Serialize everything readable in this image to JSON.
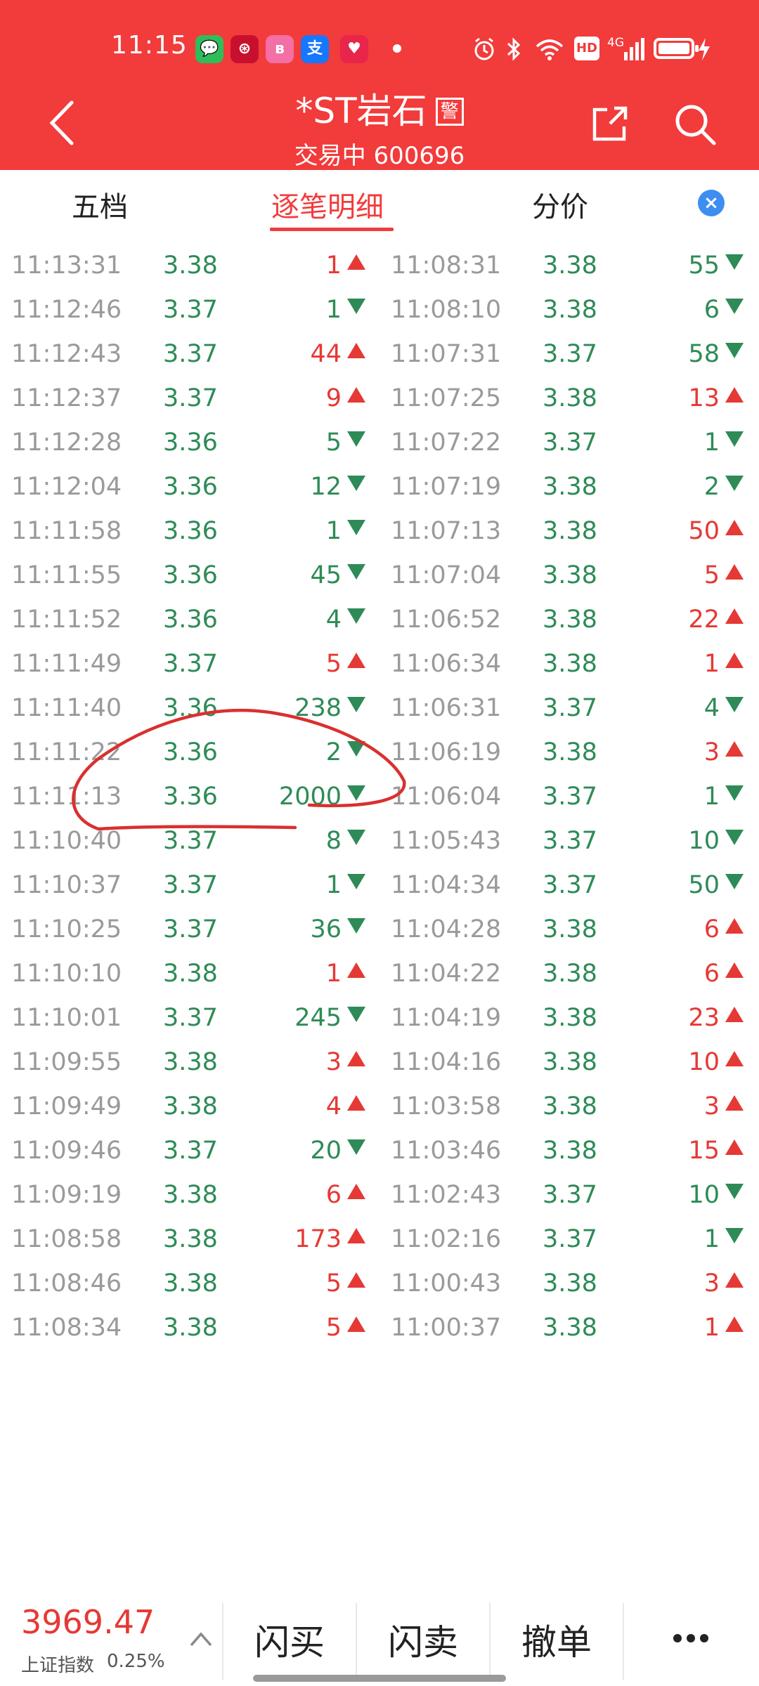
{
  "status": {
    "time": "11:15",
    "hd": "HD",
    "network": "4G",
    "notifications": [
      {
        "icon": "message-icon",
        "color": "#2fbd5a",
        "glyph": "💬"
      },
      {
        "icon": "bank-icon",
        "color": "#c8102e",
        "glyph": "⊛"
      },
      {
        "icon": "bilibili-icon",
        "color": "#f36fa5",
        "glyph": "ʙ"
      },
      {
        "icon": "alipay-icon",
        "color": "#1677ff",
        "glyph": "支"
      },
      {
        "icon": "heart-app-icon",
        "color": "#e8254a",
        "glyph": "♥"
      }
    ]
  },
  "header": {
    "stock_name": "*ST岩石",
    "warn_badge": "警",
    "status_text": "交易中",
    "stock_code": "600696"
  },
  "tabs": [
    {
      "label": "五档",
      "active": false
    },
    {
      "label": "逐笔明细",
      "active": true
    },
    {
      "label": "分价",
      "active": false
    }
  ],
  "ticks_left": [
    {
      "time": "11:13:31",
      "price": "3.38",
      "volume": "1",
      "dir": "up"
    },
    {
      "time": "11:12:46",
      "price": "3.37",
      "volume": "1",
      "dir": "down"
    },
    {
      "time": "11:12:43",
      "price": "3.37",
      "volume": "44",
      "dir": "up"
    },
    {
      "time": "11:12:37",
      "price": "3.37",
      "volume": "9",
      "dir": "up"
    },
    {
      "time": "11:12:28",
      "price": "3.36",
      "volume": "5",
      "dir": "down"
    },
    {
      "time": "11:12:04",
      "price": "3.36",
      "volume": "12",
      "dir": "down"
    },
    {
      "time": "11:11:58",
      "price": "3.36",
      "volume": "1",
      "dir": "down"
    },
    {
      "time": "11:11:55",
      "price": "3.36",
      "volume": "45",
      "dir": "down"
    },
    {
      "time": "11:11:52",
      "price": "3.36",
      "volume": "4",
      "dir": "down"
    },
    {
      "time": "11:11:49",
      "price": "3.37",
      "volume": "5",
      "dir": "up"
    },
    {
      "time": "11:11:40",
      "price": "3.36",
      "volume": "238",
      "dir": "down"
    },
    {
      "time": "11:11:22",
      "price": "3.36",
      "volume": "2",
      "dir": "down"
    },
    {
      "time": "11:11:13",
      "price": "3.36",
      "volume": "2000",
      "dir": "down"
    },
    {
      "time": "11:10:40",
      "price": "3.37",
      "volume": "8",
      "dir": "down"
    },
    {
      "time": "11:10:37",
      "price": "3.37",
      "volume": "1",
      "dir": "down"
    },
    {
      "time": "11:10:25",
      "price": "3.37",
      "volume": "36",
      "dir": "down"
    },
    {
      "time": "11:10:10",
      "price": "3.38",
      "volume": "1",
      "dir": "up"
    },
    {
      "time": "11:10:01",
      "price": "3.37",
      "volume": "245",
      "dir": "down"
    },
    {
      "time": "11:09:55",
      "price": "3.38",
      "volume": "3",
      "dir": "up"
    },
    {
      "time": "11:09:49",
      "price": "3.38",
      "volume": "4",
      "dir": "up"
    },
    {
      "time": "11:09:46",
      "price": "3.37",
      "volume": "20",
      "dir": "down"
    },
    {
      "time": "11:09:19",
      "price": "3.38",
      "volume": "6",
      "dir": "up"
    },
    {
      "time": "11:08:58",
      "price": "3.38",
      "volume": "173",
      "dir": "up"
    },
    {
      "time": "11:08:46",
      "price": "3.38",
      "volume": "5",
      "dir": "up"
    },
    {
      "time": "11:08:34",
      "price": "3.38",
      "volume": "5",
      "dir": "up"
    }
  ],
  "ticks_right": [
    {
      "time": "11:08:31",
      "price": "3.38",
      "volume": "55",
      "dir": "down"
    },
    {
      "time": "11:08:10",
      "price": "3.38",
      "volume": "6",
      "dir": "down"
    },
    {
      "time": "11:07:31",
      "price": "3.37",
      "volume": "58",
      "dir": "down"
    },
    {
      "time": "11:07:25",
      "price": "3.38",
      "volume": "13",
      "dir": "up"
    },
    {
      "time": "11:07:22",
      "price": "3.37",
      "volume": "1",
      "dir": "down"
    },
    {
      "time": "11:07:19",
      "price": "3.38",
      "volume": "2",
      "dir": "down"
    },
    {
      "time": "11:07:13",
      "price": "3.38",
      "volume": "50",
      "dir": "up"
    },
    {
      "time": "11:07:04",
      "price": "3.38",
      "volume": "5",
      "dir": "up"
    },
    {
      "time": "11:06:52",
      "price": "3.38",
      "volume": "22",
      "dir": "up"
    },
    {
      "time": "11:06:34",
      "price": "3.38",
      "volume": "1",
      "dir": "up"
    },
    {
      "time": "11:06:31",
      "price": "3.37",
      "volume": "4",
      "dir": "down"
    },
    {
      "time": "11:06:19",
      "price": "3.38",
      "volume": "3",
      "dir": "up"
    },
    {
      "time": "11:06:04",
      "price": "3.37",
      "volume": "1",
      "dir": "down"
    },
    {
      "time": "11:05:43",
      "price": "3.37",
      "volume": "10",
      "dir": "down"
    },
    {
      "time": "11:04:34",
      "price": "3.37",
      "volume": "50",
      "dir": "down"
    },
    {
      "time": "11:04:28",
      "price": "3.38",
      "volume": "6",
      "dir": "up"
    },
    {
      "time": "11:04:22",
      "price": "3.38",
      "volume": "6",
      "dir": "up"
    },
    {
      "time": "11:04:19",
      "price": "3.38",
      "volume": "23",
      "dir": "up"
    },
    {
      "time": "11:04:16",
      "price": "3.38",
      "volume": "10",
      "dir": "up"
    },
    {
      "time": "11:03:58",
      "price": "3.38",
      "volume": "3",
      "dir": "up"
    },
    {
      "time": "11:03:46",
      "price": "3.38",
      "volume": "15",
      "dir": "up"
    },
    {
      "time": "11:02:43",
      "price": "3.37",
      "volume": "10",
      "dir": "down"
    },
    {
      "time": "11:02:16",
      "price": "3.37",
      "volume": "1",
      "dir": "down"
    },
    {
      "time": "11:00:43",
      "price": "3.38",
      "volume": "3",
      "dir": "up"
    },
    {
      "time": "11:00:37",
      "price": "3.38",
      "volume": "1",
      "dir": "up"
    }
  ],
  "bottom": {
    "index_value": "3969.47",
    "index_name": "上证指数",
    "index_change": "0.25%",
    "actions": [
      "闪买",
      "闪卖",
      "撤单"
    ]
  },
  "colors": {
    "header_red": "#f23b3b",
    "up_red": "#e53935",
    "down_green": "#2e8b57",
    "close_blue": "#3d8ef0",
    "annotation_red": "#d9302f"
  }
}
